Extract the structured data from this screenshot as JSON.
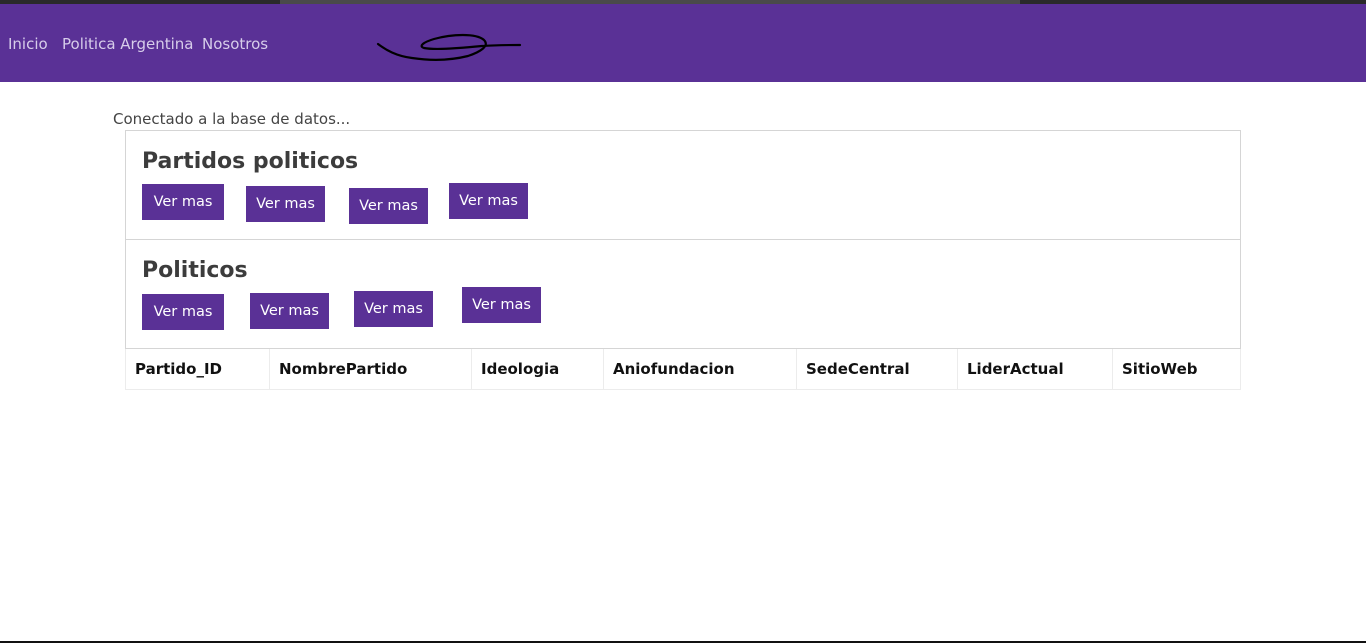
{
  "nav": {
    "links": [
      "Inicio",
      "Politica Argentina",
      "Nosotros"
    ]
  },
  "status_text": "Conectado a la base de datos...",
  "sections": [
    {
      "title": "Partidos politicos",
      "buttons": [
        "Ver mas",
        "Ver mas",
        "Ver mas",
        "Ver mas"
      ]
    },
    {
      "title": "Politicos",
      "buttons": [
        "Ver mas",
        "Ver mas",
        "Ver mas",
        "Ver mas"
      ]
    }
  ],
  "table": {
    "columns": [
      "Partido_ID",
      "NombrePartido",
      "Ideologia",
      "Aniofundacion",
      "SedeCentral",
      "LiderActual",
      "SitioWeb"
    ],
    "rows": []
  },
  "colors": {
    "brand": "#5a3196",
    "nav_link": "#d7cdea"
  }
}
